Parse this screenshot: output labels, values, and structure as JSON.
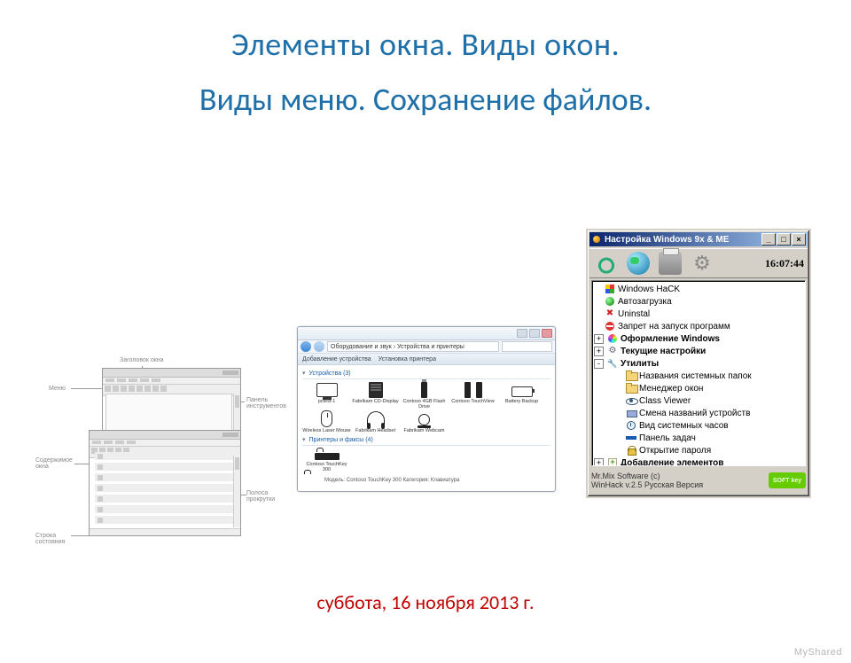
{
  "slide": {
    "title_line1": "Элементы окна. Виды окон.",
    "title_line2": "Виды меню. Сохранение файлов.",
    "date": "суббота, 16 ноября 2013 г.",
    "watermark": "MyShared"
  },
  "diagram_labels": {
    "title": "Заголовок окна",
    "menu": "Меню",
    "toolbar": "Панель инструментов",
    "content": "Содержимое окна",
    "scroll": "Полоса прокрутки",
    "status": "Строка состояния"
  },
  "devices_window": {
    "breadcrumb": "Оборудование и звук  ›  Устройства и принтеры",
    "commands": [
      "Добавление устройства",
      "Установка принтера"
    ],
    "section_devices": "Устройства (3)",
    "section_printers": "Принтеры и факсы (4)",
    "devices_row1": [
      {
        "icon": "monitor",
        "label": "pctest-1"
      },
      {
        "icon": "nas",
        "label": "Fabrikam CD-Display"
      },
      {
        "icon": "usb",
        "label": "Contoso 4GB Flash Drive"
      },
      {
        "icon": "speakers",
        "label": "Contoso TouchView"
      },
      {
        "icon": "batt",
        "label": "Battery Backup"
      }
    ],
    "devices_row2": [
      {
        "icon": "mouse",
        "label": "Wireless Laser Mouse"
      },
      {
        "icon": "headset",
        "label": "Fabrikam Headset"
      },
      {
        "icon": "webcam",
        "label": "Fabrikam Webcam"
      }
    ],
    "printers_row": [
      {
        "icon": "kbd",
        "label": "Contoso TouchKey 300"
      }
    ],
    "details_line": "Модель:  Contoso TouchKey 300        Категория:  Клавиатура"
  },
  "win9x": {
    "title": "Настройка Windows 9x & ME",
    "clock": "16:07:44",
    "tree": [
      {
        "depth": 0,
        "ex": "",
        "icon": "win",
        "label": "Windows HaCK"
      },
      {
        "depth": 0,
        "ex": "",
        "icon": "boot",
        "label": "Автозагрузка"
      },
      {
        "depth": 0,
        "ex": "",
        "icon": "del",
        "label": "Uninstal"
      },
      {
        "depth": 0,
        "ex": "",
        "icon": "no",
        "label": "Запрет на запуск программ"
      },
      {
        "depth": 0,
        "ex": "+",
        "icon": "pal",
        "label": "Оформление Windows",
        "bold": true
      },
      {
        "depth": 0,
        "ex": "+",
        "icon": "gear",
        "label": "Текущие настройки",
        "bold": true
      },
      {
        "depth": 0,
        "ex": "-",
        "icon": "tool",
        "label": "Утилиты",
        "bold": true
      },
      {
        "depth": 1,
        "ex": "",
        "icon": "fold",
        "label": "Названия системных папок"
      },
      {
        "depth": 1,
        "ex": "",
        "icon": "fold",
        "label": "Менеджер окон"
      },
      {
        "depth": 1,
        "ex": "",
        "icon": "eye",
        "label": "Class Viewer"
      },
      {
        "depth": 1,
        "ex": "",
        "icon": "dev",
        "label": "Смена названий устройств"
      },
      {
        "depth": 1,
        "ex": "",
        "icon": "clock",
        "label": "Вид системных часов"
      },
      {
        "depth": 1,
        "ex": "",
        "icon": "task",
        "label": "Панель задач"
      },
      {
        "depth": 1,
        "ex": "",
        "icon": "lock",
        "label": "Открытие пароля"
      },
      {
        "depth": 0,
        "ex": "+",
        "icon": "plus",
        "label": "Добавление элементов",
        "bold": true
      }
    ],
    "footer_line1": "Mr.Mix Software (c)",
    "footer_line2": "WinHack v.2.5 Русская Версия",
    "badge": "SOFT key"
  }
}
